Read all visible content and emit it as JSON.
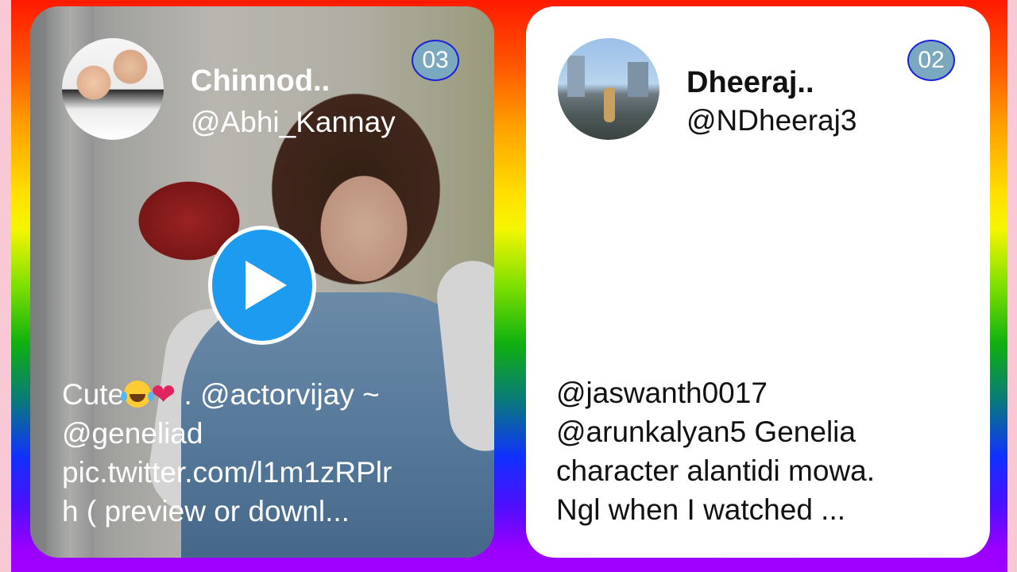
{
  "cards": [
    {
      "display_name": "Chinnod..",
      "handle": "@Abhi_Kannay",
      "rank": "03",
      "has_video": true,
      "text_lines": [
        {
          "before": "Cute",
          "emoji": "laughing-tears-emoji",
          "heart": "❤",
          "after": " . @actorvijay ~"
        },
        {
          "text": "@geneliad"
        },
        {
          "text": "pic.twitter.com/l1m1zRPlr"
        },
        {
          "text": "h ( preview or downl..."
        }
      ]
    },
    {
      "display_name": "Dheeraj..",
      "handle": "@NDheeraj3",
      "rank": "02",
      "has_video": false,
      "text_lines": [
        {
          "text": "@jaswanth0017"
        },
        {
          "text": "@arunkalyan5 Genelia"
        },
        {
          "text": "character alantidi mowa."
        },
        {
          "text": "Ngl when I watched ..."
        }
      ]
    }
  ],
  "colors": {
    "play_button": "#1d9bf0",
    "badge_fill": "#7aa8be",
    "badge_border": "#1a22d8",
    "heart": "#e0245e"
  }
}
